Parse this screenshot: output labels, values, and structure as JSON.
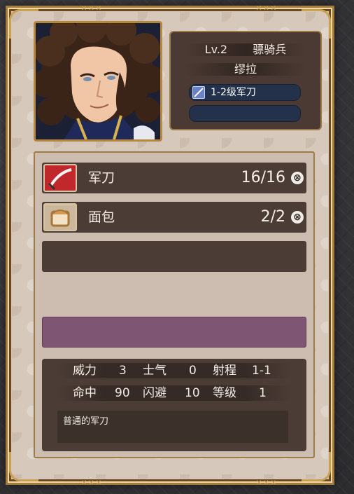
{
  "unit": {
    "level": "Lv.2",
    "class": "骠骑兵",
    "name": "缪拉",
    "equipped_weapon": "1-2级军刀",
    "second_slot": ""
  },
  "inventory": [
    {
      "name": "军刀",
      "count": "16/16",
      "icon": "saber-icon"
    },
    {
      "name": "面包",
      "count": "2/2",
      "icon": "bread-icon"
    }
  ],
  "stats": {
    "power_label": "威力",
    "power": "3",
    "morale_label": "士气",
    "morale": "0",
    "range_label": "射程",
    "range": "1-1",
    "hit_label": "命中",
    "hit": "90",
    "evade_label": "闪避",
    "evade": "10",
    "grade_label": "等级",
    "grade": "1"
  },
  "description": "普通的军刀",
  "drop_symbol": "⊗",
  "colors": {
    "frame_gold": "#caa052",
    "panel_bg": "#d6c9bc",
    "row_bg": "#4c3c36",
    "desc_bar": "#7e5572",
    "slot_blue": "#23324a"
  }
}
